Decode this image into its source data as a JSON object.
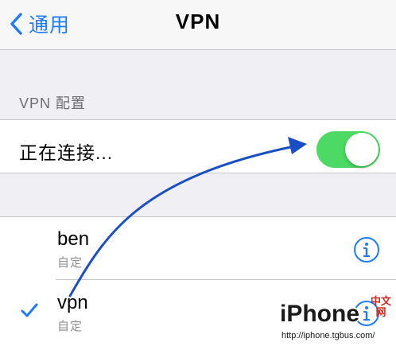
{
  "navbar": {
    "back_label": "通用",
    "title": "VPN",
    "back_icon": "chevron-left-icon"
  },
  "vpn_config": {
    "section_header": "VPN 配置",
    "status_label": "正在连接...",
    "toggle_on": true
  },
  "vpn_list": [
    {
      "name": "ben",
      "subtitle": "自定",
      "selected": false
    },
    {
      "name": "vpn",
      "subtitle": "自定",
      "selected": true
    }
  ],
  "watermark": {
    "text": "iPhone",
    "cn": "中文网",
    "url": "http://iphone.tgbus.com/"
  },
  "colors": {
    "accent": "#1f7cf6",
    "toggle_on": "#4cd964",
    "annotation_arrow": "#1a4fc4",
    "background": "#efeff4"
  }
}
